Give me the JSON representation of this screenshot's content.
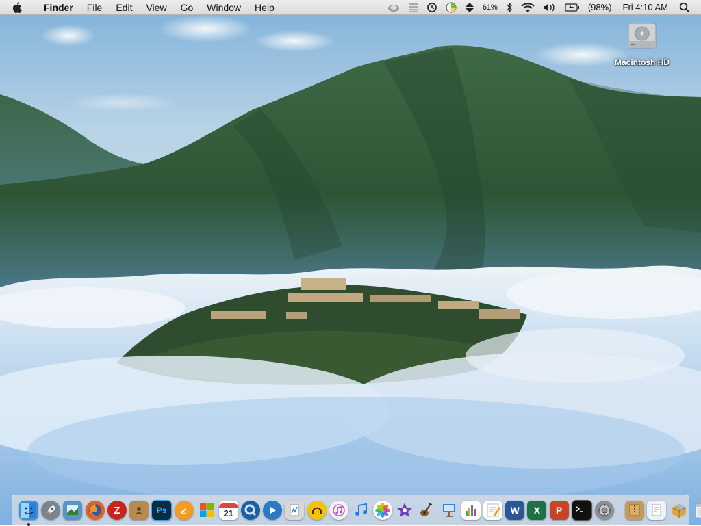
{
  "menubar": {
    "app_name": "Finder",
    "items": [
      "File",
      "Edit",
      "View",
      "Go",
      "Window",
      "Help"
    ],
    "status": {
      "battery_percent_label": "61%",
      "battery_percent_label_2": "(98%)",
      "clock": "Fri 4:10 AM"
    },
    "status_icons": [
      "cloud-icon",
      "list-icon",
      "time-machine-icon",
      "color-wheel-icon",
      "up-down-arrows-icon",
      "bluetooth-icon",
      "wifi-icon",
      "volume-icon",
      "battery-icon",
      "spotlight-icon"
    ]
  },
  "desktop": {
    "icons": [
      {
        "label": "Macintosh HD",
        "icon": "hard-drive-icon"
      }
    ]
  },
  "dock": {
    "apps": [
      {
        "name": "Finder",
        "icon": "finder-icon",
        "running": true,
        "color": "#3b8fe0"
      },
      {
        "name": "Launchpad",
        "icon": "rocket-icon",
        "running": false,
        "color": "#7a8592"
      },
      {
        "name": "Preview",
        "icon": "preview-icon",
        "running": false,
        "color": "#5a93c8"
      },
      {
        "name": "Firefox",
        "icon": "firefox-icon",
        "running": false,
        "color": "#e8601c"
      },
      {
        "name": "FileZilla",
        "icon": "filezilla-icon",
        "running": false,
        "color": "#c9231c"
      },
      {
        "name": "Contacts",
        "icon": "contacts-icon",
        "running": false,
        "color": "#b9894e"
      },
      {
        "name": "Photoshop",
        "icon": "photoshop-icon",
        "running": false,
        "color": "#0d2a3e"
      },
      {
        "name": "Swift",
        "icon": "swift-icon",
        "running": false,
        "color": "#f59b24"
      },
      {
        "name": "Windows",
        "icon": "windows-icon",
        "running": false,
        "color": "#ffffff"
      },
      {
        "name": "Calendar",
        "icon": "calendar-icon",
        "running": false,
        "color": "#ffffff"
      },
      {
        "name": "QuickTime Player",
        "icon": "quicktime-icon",
        "running": false,
        "color": "#1e5f9e"
      },
      {
        "name": "Media Player",
        "icon": "play-icon",
        "running": false,
        "color": "#2b79c7"
      },
      {
        "name": "Instruments",
        "icon": "instruments-icon",
        "running": false,
        "color": "#d8d8d8"
      },
      {
        "name": "Headphones",
        "icon": "headphones-icon",
        "running": false,
        "color": "#f4c400"
      },
      {
        "name": "iTunes",
        "icon": "itunes-icon",
        "running": false,
        "color": "#f3f3f3"
      },
      {
        "name": "Music",
        "icon": "music-icon",
        "running": false,
        "color": "#1a7fe0"
      },
      {
        "name": "Photos",
        "icon": "photos-icon",
        "running": false,
        "color": "#ffffff"
      },
      {
        "name": "iMovie",
        "icon": "imovie-icon",
        "running": false,
        "color": "#6f3fc0"
      },
      {
        "name": "GarageBand",
        "icon": "guitar-icon",
        "running": false,
        "color": "#8a5a2b"
      },
      {
        "name": "Keynote",
        "icon": "keynote-icon",
        "running": false,
        "color": "#2f83e0"
      },
      {
        "name": "Numbers",
        "icon": "numbers-icon",
        "running": false,
        "color": "#2fb344"
      },
      {
        "name": "Pages",
        "icon": "pages-icon",
        "running": false,
        "color": "#f19a1c"
      },
      {
        "name": "Word",
        "icon": "word-icon",
        "running": false,
        "color": "#2b5797"
      },
      {
        "name": "Excel",
        "icon": "excel-icon",
        "running": false,
        "color": "#1e7145"
      },
      {
        "name": "PowerPoint",
        "icon": "powerpoint-icon",
        "running": false,
        "color": "#c94427"
      },
      {
        "name": "Terminal",
        "icon": "terminal-icon",
        "running": false,
        "color": "#111111"
      },
      {
        "name": "System Preferences",
        "icon": "gear-icon",
        "running": false,
        "color": "#8b8f96"
      }
    ],
    "others": [
      {
        "name": "Archive Utility",
        "icon": "archive-icon",
        "color": "#c79a55"
      },
      {
        "name": "Documents",
        "icon": "document-icon",
        "color": "#eef2f7"
      },
      {
        "name": "Installer",
        "icon": "package-icon",
        "color": "#d9a84a"
      },
      {
        "name": "Trash",
        "icon": "trash-icon",
        "color": "#e6e9ed"
      }
    ],
    "calendar_day": "21",
    "photoshop_label": "Ps",
    "word_label": "W",
    "excel_label": "X",
    "powerpoint_label": "P"
  }
}
